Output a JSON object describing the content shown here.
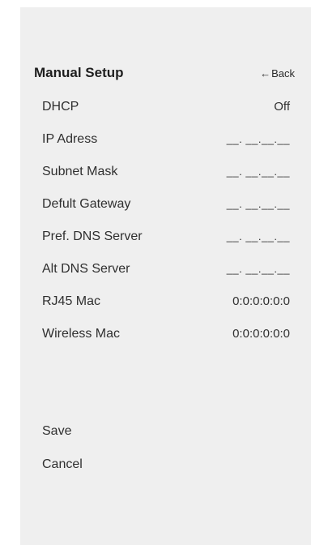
{
  "screen": {
    "title": "Manual Setup",
    "back_label": "Back",
    "back_icon": "left-arrow-icon"
  },
  "settings": [
    {
      "label": "DHCP",
      "value": "Off"
    },
    {
      "label": "IP Adress",
      "value": "__. __.__.__"
    },
    {
      "label": "Subnet Mask",
      "value": "__. __.__.__"
    },
    {
      "label": "Defult Gateway",
      "value": "__. __.__.__"
    },
    {
      "label": "Pref. DNS Server",
      "value": "__. __.__.__"
    },
    {
      "label": "Alt DNS Server",
      "value": "__. __.__.__"
    },
    {
      "label": "RJ45 Mac",
      "value": "0:0:0:0:0:0"
    },
    {
      "label": "Wireless Mac",
      "value": "0:0:0:0:0:0"
    }
  ],
  "actions": {
    "save_label": "Save",
    "cancel_label": "Cancel"
  },
  "colors": {
    "panel_background": "#efefef",
    "page_background": "#ffffff",
    "text": "#2f2f2f"
  }
}
